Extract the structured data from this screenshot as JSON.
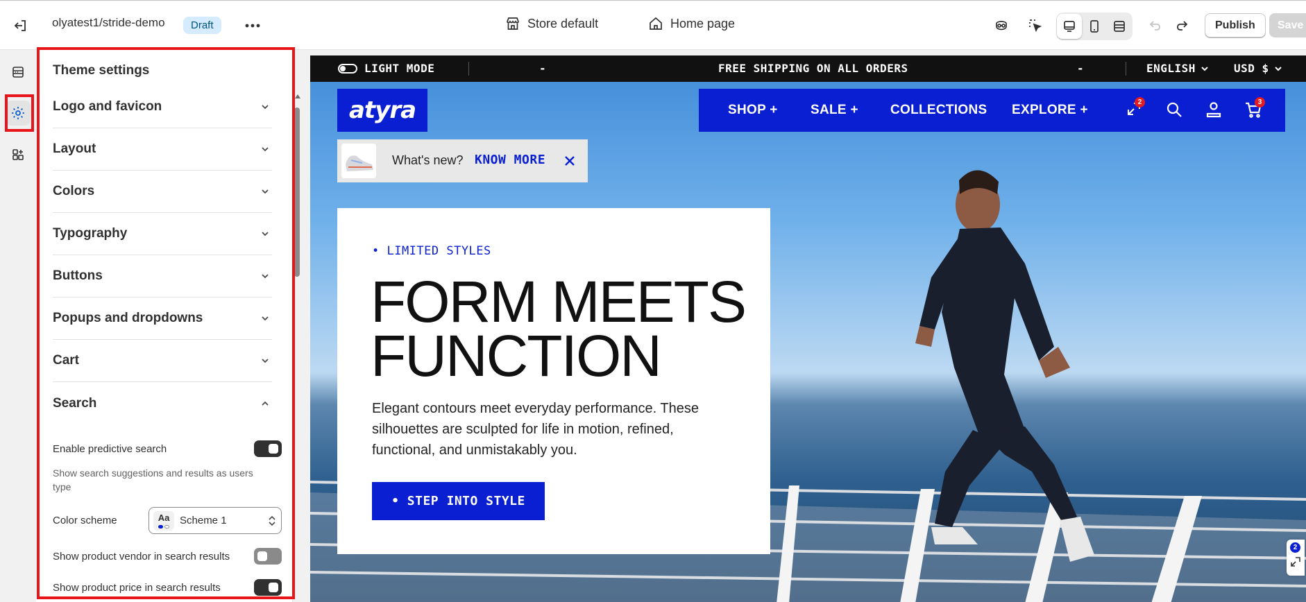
{
  "topbar": {
    "store_name": "olyatest1/stride-demo",
    "status_badge": "Draft",
    "theme_selector": "Store default",
    "page_selector": "Home page",
    "publish_label": "Publish",
    "save_label": "Save"
  },
  "sidebar": {
    "title": "Theme settings",
    "sections": [
      {
        "label": "Logo and favicon",
        "expanded": false
      },
      {
        "label": "Layout",
        "expanded": false
      },
      {
        "label": "Colors",
        "expanded": false
      },
      {
        "label": "Typography",
        "expanded": false
      },
      {
        "label": "Buttons",
        "expanded": false
      },
      {
        "label": "Popups and dropdowns",
        "expanded": false
      },
      {
        "label": "Cart",
        "expanded": false
      },
      {
        "label": "Search",
        "expanded": true
      }
    ],
    "search_settings": {
      "predictive_label": "Enable predictive search",
      "predictive_on": true,
      "predictive_help": "Show search suggestions and results as users type",
      "color_scheme_label": "Color scheme",
      "color_scheme_value": "Scheme 1",
      "color_scheme_swatch_text": "Aa",
      "vendor_label": "Show product vendor in search results",
      "vendor_on": false,
      "price_label": "Show product price in search results",
      "price_on": true
    }
  },
  "preview": {
    "announcement": {
      "mode_label": "LIGHT MODE",
      "separator_left": "-",
      "message": "FREE SHIPPING ON ALL ORDERS",
      "separator_right": "-",
      "language": "ENGLISH",
      "currency": "USD $"
    },
    "logo_text": "atyra",
    "nav": {
      "links": [
        "SHOP +",
        "SALE +",
        "COLLECTIONS",
        "EXPLORE +"
      ],
      "compare_count": "2",
      "cart_count": "3"
    },
    "whats_new": {
      "text": "What's new?",
      "link": "KNOW MORE"
    },
    "hero": {
      "eyebrow": "• LIMITED STYLES",
      "title": "FORM MEETS FUNCTION",
      "body": "Elegant contours meet everyday performance. These silhouettes are sculpted for life in motion, refined, functional, and unmistakably you.",
      "cta": "• STEP INTO STYLE"
    },
    "floating_compare_count": "2"
  },
  "colors": {
    "brand_blue": "#0a1fd1",
    "highlight_red": "#e8151b",
    "badge_bg": "#d5ebff"
  }
}
